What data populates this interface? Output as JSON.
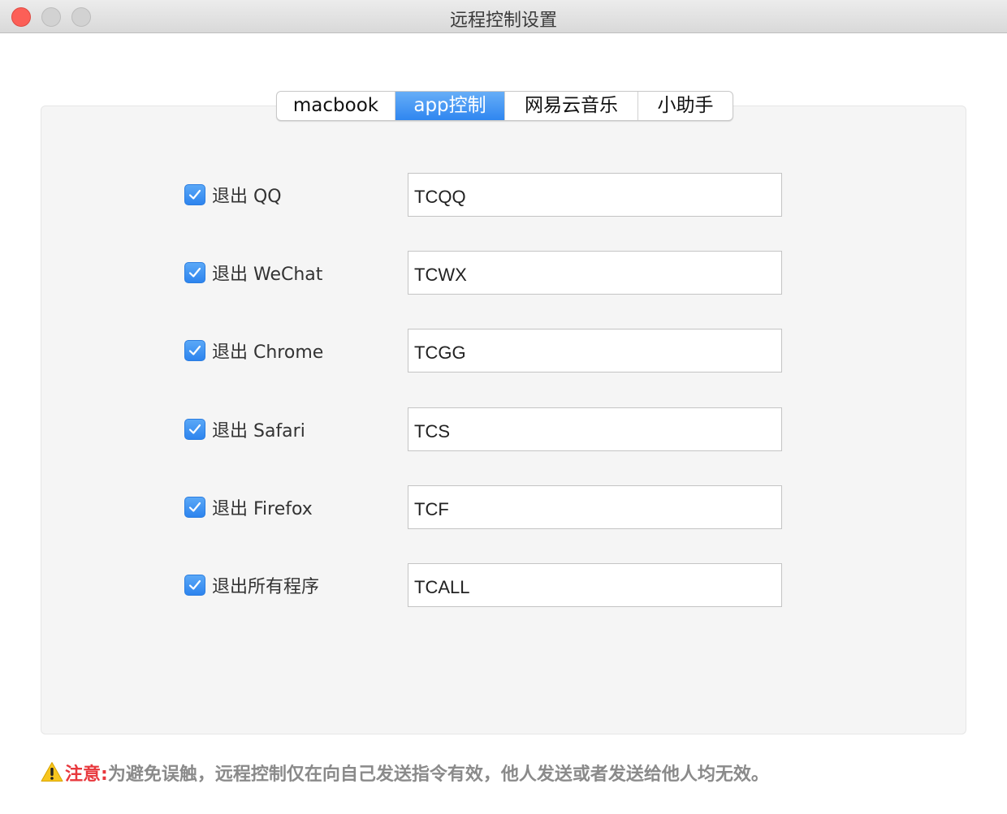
{
  "window": {
    "title": "远程控制设置"
  },
  "tabs": [
    {
      "label": "macbook",
      "active": false
    },
    {
      "label": "app控制",
      "active": true
    },
    {
      "label": "网易云音乐",
      "active": false
    },
    {
      "label": "小助手",
      "active": false
    }
  ],
  "rows": [
    {
      "label": "退出 QQ",
      "checked": true,
      "command": "TCQQ"
    },
    {
      "label": "退出 WeChat",
      "checked": true,
      "command": "TCWX"
    },
    {
      "label": "退出 Chrome",
      "checked": true,
      "command": "TCGG"
    },
    {
      "label": "退出 Safari",
      "checked": true,
      "command": "TCS"
    },
    {
      "label": "退出 Firefox",
      "checked": true,
      "command": "TCF"
    },
    {
      "label": "退出所有程序",
      "checked": true,
      "command": "TCALL"
    }
  ],
  "note": {
    "icon": "warning-icon",
    "label": "注意:",
    "text": "为避免误触，远程控制仅在向自己发送指令有效，他人发送或者发送给他人均无效。"
  },
  "colors": {
    "accent": "#2f86f0",
    "warning": "#e8383d",
    "close_button": "#fc5f57"
  }
}
